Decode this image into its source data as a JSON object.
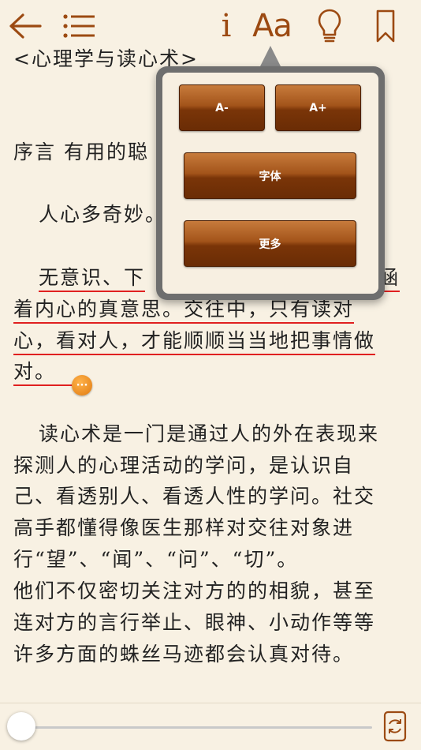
{
  "toolbar": {
    "info_label": "i",
    "font_label": "Aa"
  },
  "book": {
    "title_line": "<心理学与读心术>",
    "lines": [
      "序言 有用的聪",
      "人心多奇妙。",
      "无意识、下",
      "着内心的真意思。交往中，只有读对",
      "心，看对人，才能顺顺当当地把事情做",
      "对。",
      "读心术是一门是通过人的外在表现来",
      "探测人的心理活动的学问，是认识自",
      "己、看透别人、看透人性的学问。社交",
      "高手都懂得像医生那样对交往对象进",
      "行“望”、“闻”、“问”、“切”。",
      "他们不仅密切关注对方的的相貌，甚至",
      "连对方的言行举止、眼神、小动作等等",
      "许多方面的蛛丝马迹都会认真对待。"
    ],
    "clipped_tail": "涵",
    "note_glyph": "···"
  },
  "popover": {
    "decrease_label": "A-",
    "increase_label": "A+",
    "font_button_label": "字体",
    "more_button_label": "更多"
  },
  "progress": {
    "value": 0.0
  },
  "colors": {
    "accent": "#9c4a12",
    "highlight_underline": "#e02020",
    "paper": "#f8f1e3",
    "button_brown": "#7a3508"
  }
}
